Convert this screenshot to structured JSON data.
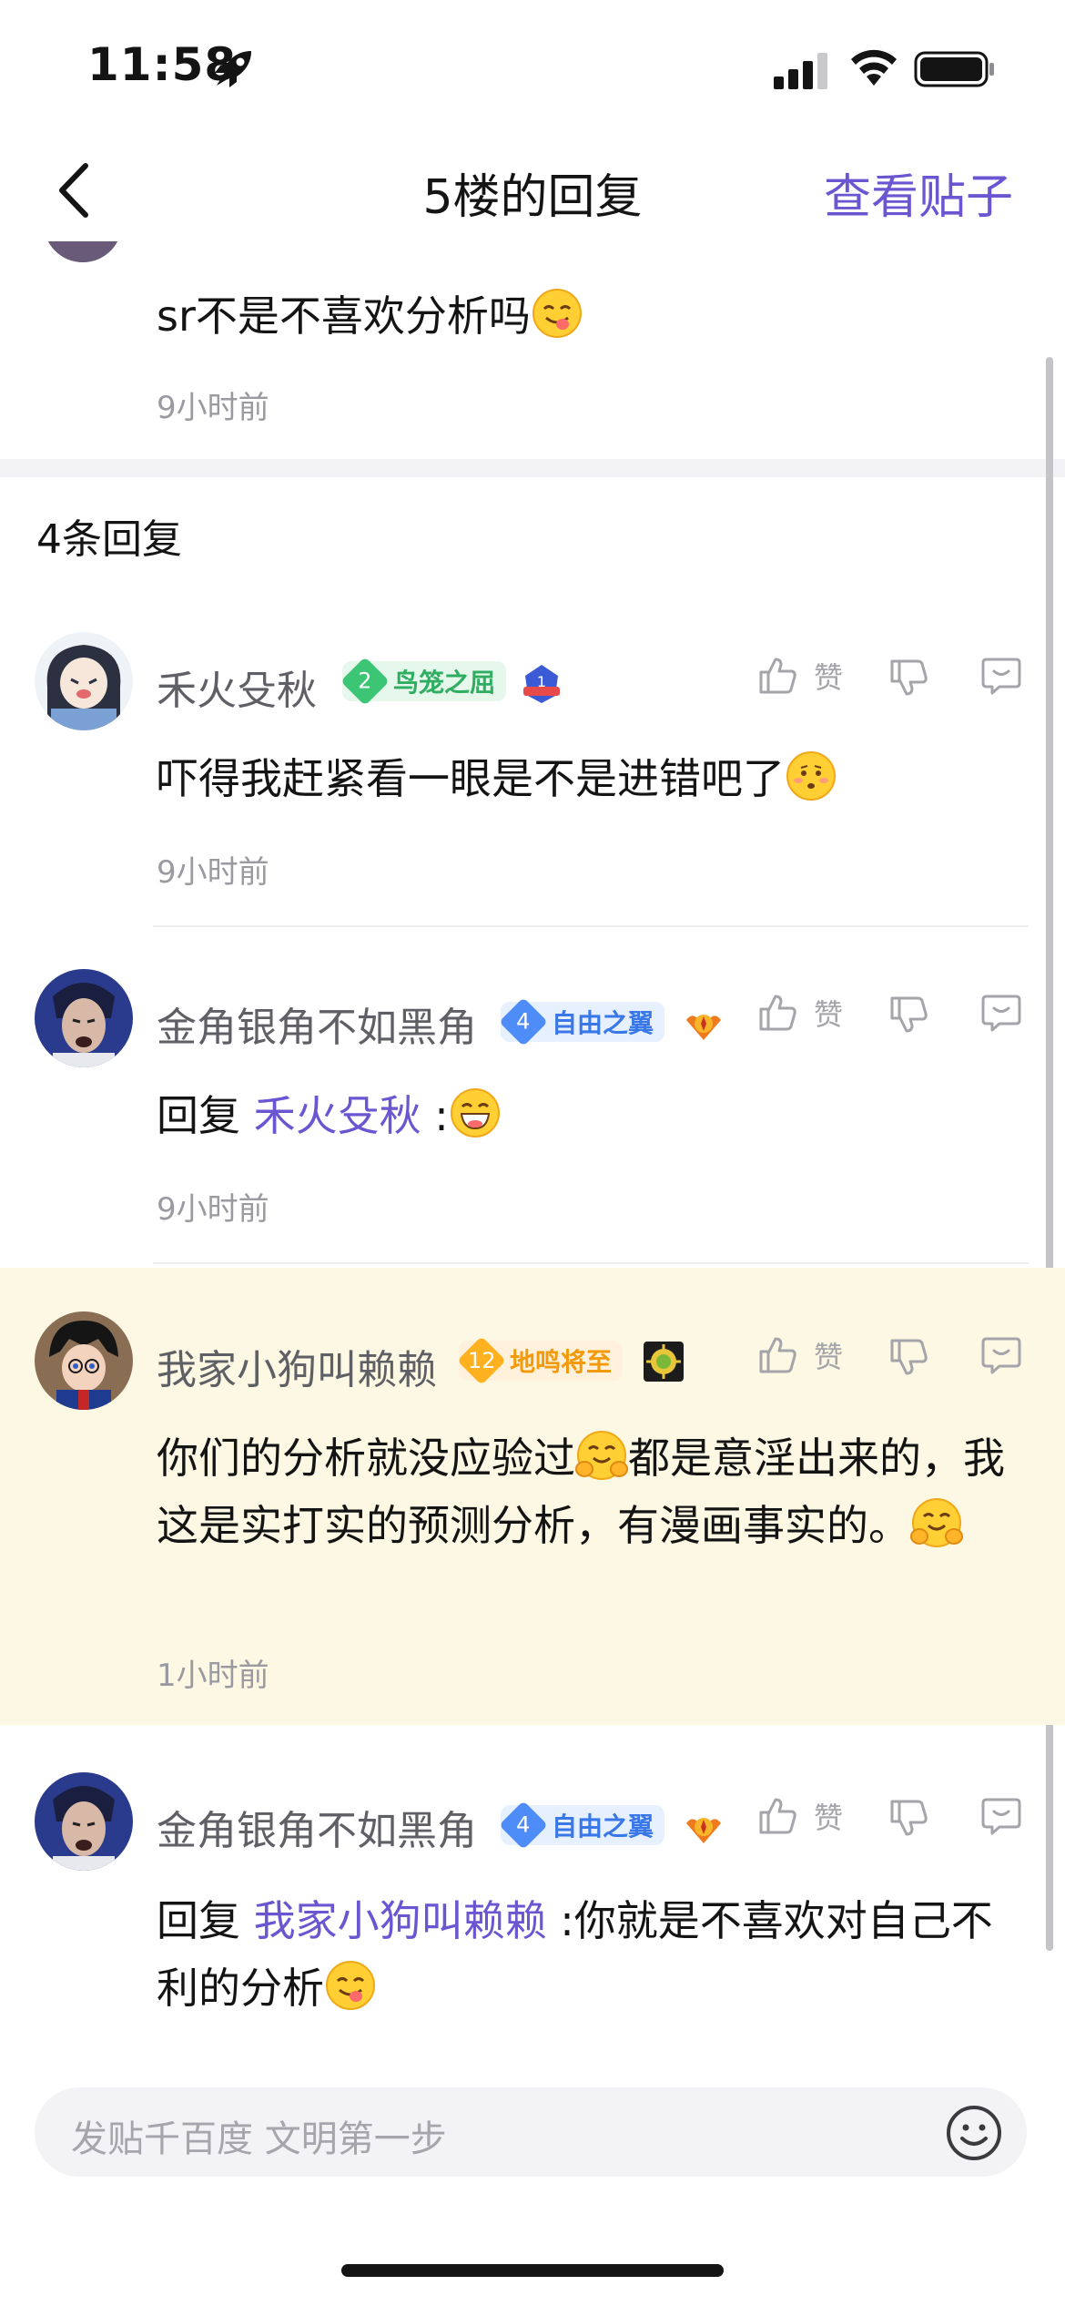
{
  "status_bar": {
    "time": "11:58"
  },
  "nav": {
    "title": "5楼的回复",
    "action": "查看贴子"
  },
  "top_post": {
    "text": "sr不是不喜欢分析吗",
    "time": "9小时前"
  },
  "replies_header": "4条回复",
  "like_label": "赞",
  "reply_prefix": "回复",
  "comments": [
    {
      "username": "禾火殳秋",
      "badge": {
        "level": "2",
        "name": "鸟笼之屈"
      },
      "text": "吓得我赶紧看一眼是不是进错吧了",
      "time": "9小时前"
    },
    {
      "username": "金角银角不如黑角",
      "badge": {
        "level": "4",
        "name": "自由之翼"
      },
      "reply_to": "禾火殳秋",
      "text": " :",
      "time": "9小时前"
    },
    {
      "username": "我家小狗叫赖赖",
      "badge": {
        "level": "12",
        "name": "地鸣将至"
      },
      "text_part1": "你们的分析就没应验过",
      "text_part2": "都是意淫出来的，我这是实打实的预测分析，有漫画事实的。",
      "time": "1小时前"
    },
    {
      "username": "金角银角不如黑角",
      "badge": {
        "level": "4",
        "name": "自由之翼"
      },
      "reply_to": "我家小狗叫赖赖",
      "text": " :你就是不喜欢对自己不利的分析"
    }
  ],
  "input": {
    "placeholder": "发贴千百度 文明第一步"
  },
  "colors": {
    "accent": "#6b55d1",
    "highlight_bg": "#fdf8e3",
    "muted": "#9a9aa0"
  }
}
